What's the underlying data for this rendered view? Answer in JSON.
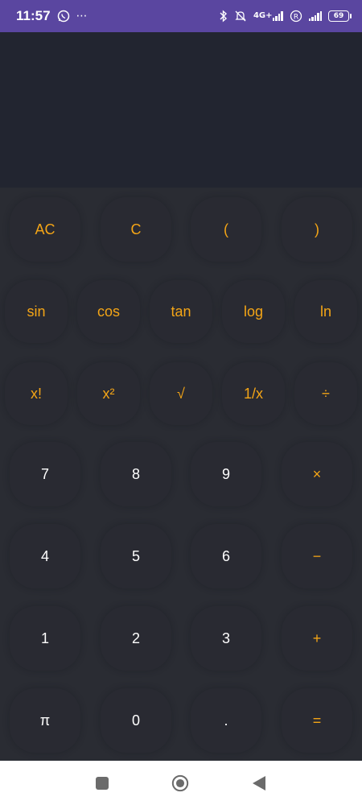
{
  "status_bar": {
    "time": "11:57",
    "more_icon": "⋯",
    "network": "4G+",
    "battery": "69",
    "icons": [
      "whatsapp-icon",
      "more-icon",
      "bluetooth-icon",
      "bell-off-icon",
      "signal-icon",
      "roaming-icon",
      "battery-icon"
    ]
  },
  "keypad": {
    "row1": [
      "AC",
      "C",
      "(",
      ")"
    ],
    "row2": [
      "sin",
      "cos",
      "tan",
      "log",
      "ln"
    ],
    "row3": [
      "x!",
      "x²",
      "√",
      "1/x",
      "÷"
    ],
    "row4": [
      "7",
      "8",
      "9",
      "×"
    ],
    "row5": [
      "4",
      "5",
      "6",
      "−"
    ],
    "row6": [
      "1",
      "2",
      "3",
      "+"
    ],
    "row7": [
      "π",
      "0",
      ".",
      "="
    ]
  },
  "colors": {
    "status_bar": "#5a46a0",
    "display_bg": "#222530",
    "keypad_bg": "#2a2c33",
    "accent": "#f4a516",
    "digit": "#ffffff",
    "nav_bar": "#ffffff"
  },
  "nav": {
    "icons": [
      "recents-icon",
      "home-icon",
      "back-icon"
    ]
  }
}
